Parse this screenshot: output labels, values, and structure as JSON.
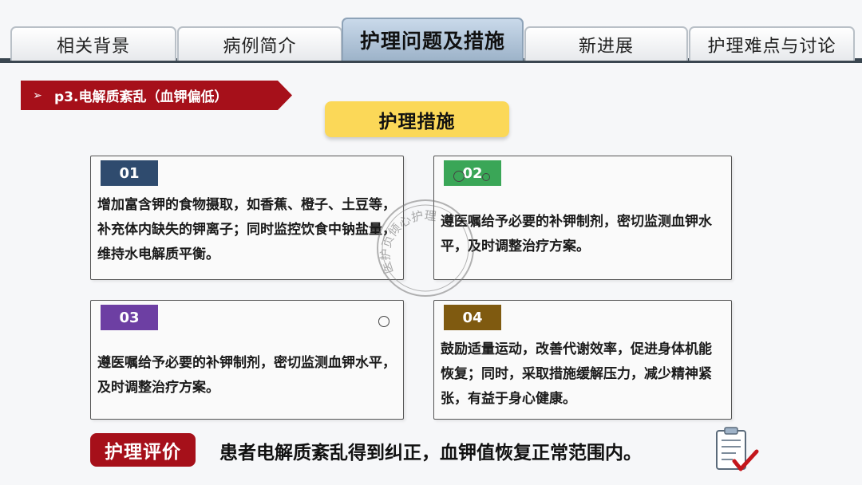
{
  "tabs": [
    {
      "label": "相关背景",
      "active": false
    },
    {
      "label": "病例简介",
      "active": false
    },
    {
      "label": "护理问题及措施",
      "active": true
    },
    {
      "label": "新进展",
      "active": false
    },
    {
      "label": "护理难点与讨论",
      "active": false
    }
  ],
  "section": {
    "arrow": "➢",
    "title": "p3.电解质紊乱（血钾偏低）"
  },
  "measures_title": "护理措施",
  "cards": [
    {
      "number": "01",
      "color": "#2f4b6e",
      "text": "增加富含钾的食物摄取，如香蕉、橙子、土豆等，补充体内缺失的钾离子；同时监控饮食中钠盐量，维持水电解质平衡。"
    },
    {
      "number": "02",
      "color": "#3aa657",
      "text": "遵医嘱给予必要的补钾制剂，密切监测血钾水平，及时调整治疗方案。"
    },
    {
      "number": "03",
      "color": "#6d3fa3",
      "text": "遵医嘱给予必要的补钾制剂，密切监测血钾水平，及时调整治疗方案。"
    },
    {
      "number": "04",
      "color": "#7f5a10",
      "text": "鼓励适量运动，改善代谢效率，促进身体机能恢复；同时，采取措施缓解压力，减少精神紧张，有益于身心健康。"
    }
  ],
  "watermark": "医护页倾心护理",
  "evaluation": {
    "label": "护理评价",
    "text": "患者电解质紊乱得到纠正，血钾值恢复正常范围内。"
  },
  "icons": {
    "ribbon": "arrow-bullet-icon",
    "clipboard": "checklist-clipboard-icon"
  },
  "colors": {
    "accent_red": "#a6101a",
    "title_yellow": "#fbd858",
    "tab_bar": "#3a4650"
  }
}
